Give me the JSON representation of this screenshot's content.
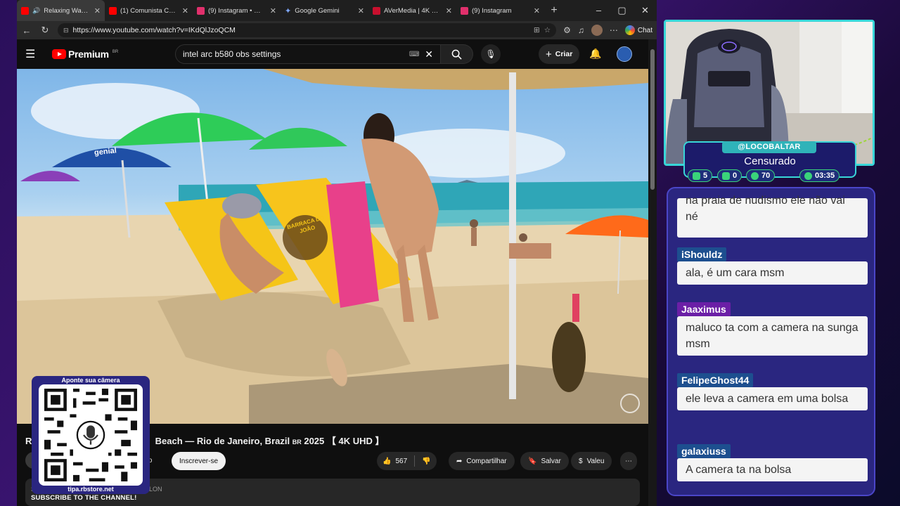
{
  "browser": {
    "tabs": [
      {
        "title": "Relaxing Walking",
        "color": "#ff0000",
        "active": true
      },
      {
        "title": "(1) Comunista CHORA",
        "color": "#ff0000",
        "active": false
      },
      {
        "title": "(9) Instagram • Mensa",
        "color": "#e1306c",
        "active": false
      },
      {
        "title": "Google Gemini",
        "color": "#4f8df5",
        "active": false
      },
      {
        "title": "AVerMedia | 4K HDMI",
        "color": "#c8102e",
        "active": false
      },
      {
        "title": "(9) Instagram",
        "color": "#e1306c",
        "active": false
      }
    ],
    "url": "https://www.youtube.com/watch?v=IKdQlJzoQCM",
    "chat_label": "Chat"
  },
  "youtube": {
    "logo": "Premium",
    "logo_country": "BR",
    "search_value": "intel arc b580 obs settings",
    "create_label": "Criar",
    "video_title_prefix": "R",
    "video_title": "Beach — Rio de Janeiro, Brazil",
    "video_title_country": "BR",
    "video_title_suffix": "2025 【 4K UHD 】",
    "member_text": "bro",
    "subscribe_label": "Inscrever-se",
    "likes": "567",
    "share_label": "Compartilhar",
    "save_label": "Salvar",
    "thanks_label": "Valeu",
    "desc_fragment": "LON",
    "desc_prefix": "S",
    "umbrella_brand": "genial",
    "chair_text": "BARRACA DO JOÃO"
  },
  "qr": {
    "top_text": "Aponte sua câmera",
    "bottom_text": "tipa.rbstore.net"
  },
  "banner": "SUBSCRIBE TO THE CHANNEL!",
  "streamer": {
    "handle": "@LOCOBALTAR",
    "status": "Censurado",
    "stats": [
      {
        "icon": "chat-icon",
        "value": "5"
      },
      {
        "icon": "video-icon",
        "value": "0"
      },
      {
        "icon": "refresh-icon",
        "value": "70"
      },
      {
        "icon": "clock-icon",
        "value": "03:35"
      }
    ]
  },
  "chat": [
    {
      "user": "",
      "user_color": "#1d4f8f",
      "text": "na praia de nudismo ele não vai né"
    },
    {
      "user": "iShouldz",
      "user_color": "#1d4f8f",
      "text": "ala, é um cara msm"
    },
    {
      "user": "Jaaximus",
      "user_color": "#6b1fa6",
      "text": "maluco ta com a camera na sunga msm"
    },
    {
      "user": "FelipeGhost44",
      "user_color": "#1d4f8f",
      "text": "ele leva a camera em uma bolsa"
    },
    {
      "user": "galaxiuss",
      "user_color": "#1d4f8f",
      "text": "A camera ta na bolsa"
    }
  ]
}
